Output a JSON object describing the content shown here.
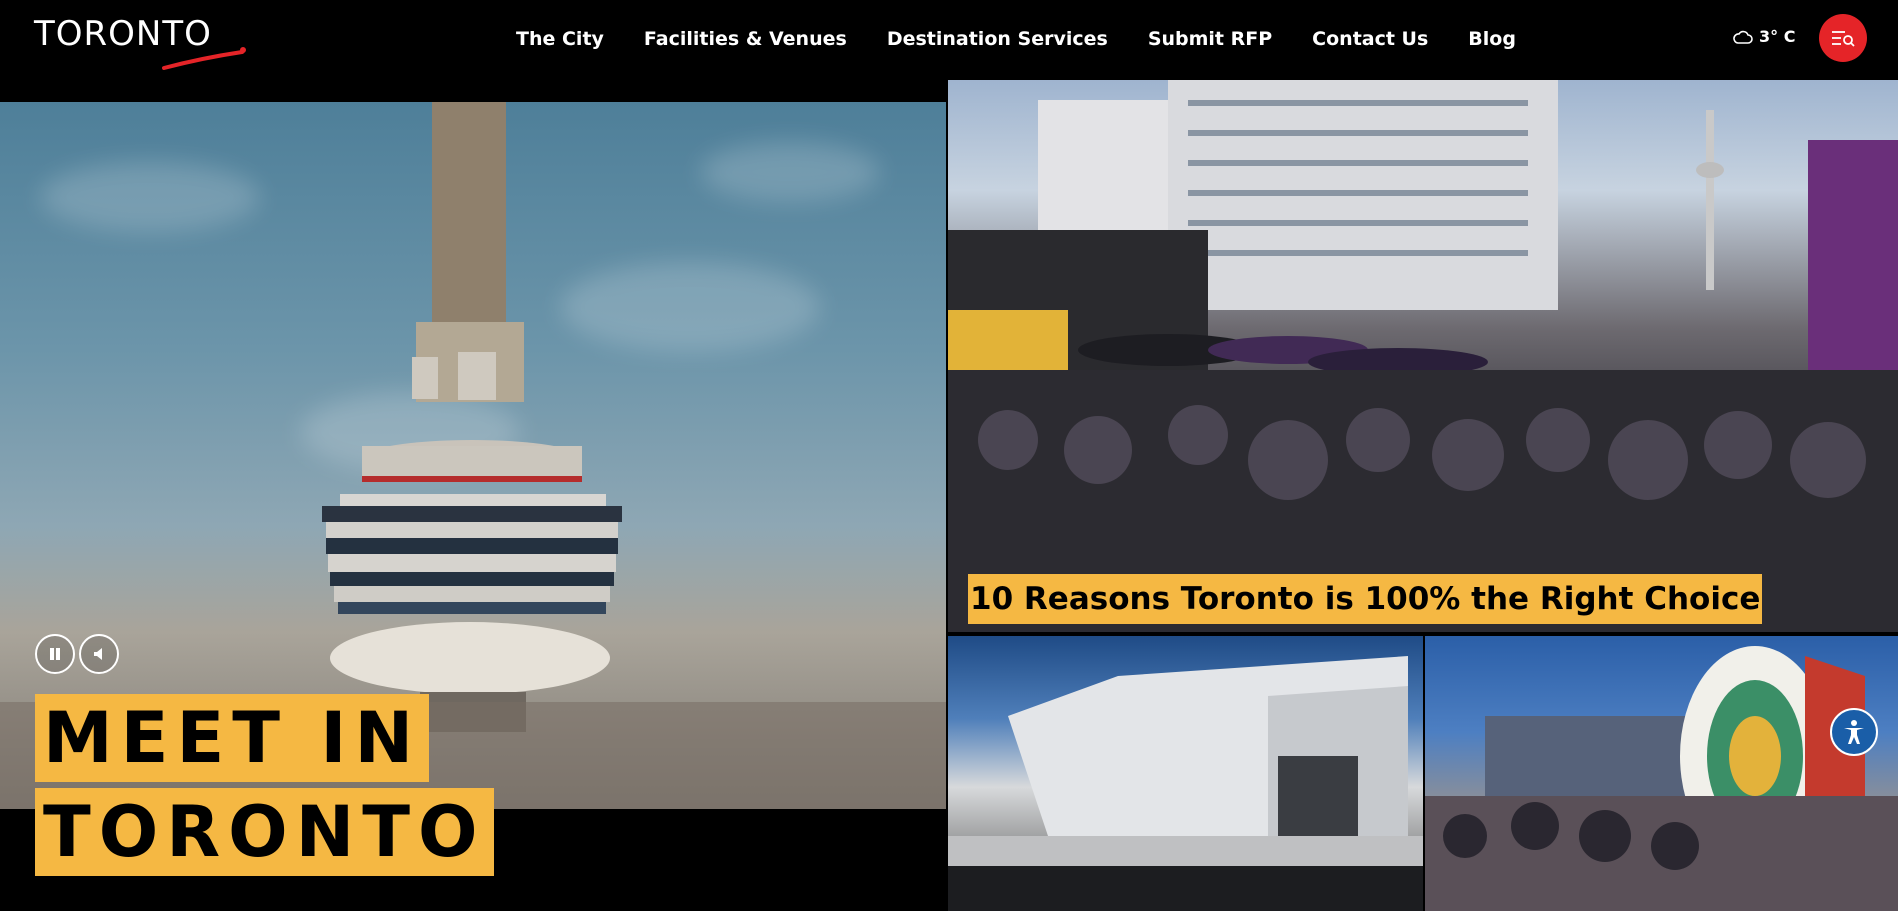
{
  "header": {
    "logo_text": "TORONTO",
    "nav": [
      "The City",
      "Facilities & Venues",
      "Destination Services",
      "Submit RFP",
      "Contact Us",
      "Blog"
    ],
    "weather": "3° C",
    "weather_icon": "cloud-icon",
    "menu_icon": "menu-search-icon"
  },
  "hero": {
    "title_line1": "MEET IN",
    "title_line2": "TORONTO",
    "controls": [
      "pause-icon",
      "mute-icon"
    ]
  },
  "featured": {
    "title": "10 Reasons Toronto is 100% the Right Choice"
  },
  "colors": {
    "accent_yellow": "#f5b843",
    "menu_red": "#e52428",
    "background": "#000000",
    "a11y_blue": "#1a5ea8"
  },
  "accessibility": {
    "icon": "accessibility-icon"
  }
}
